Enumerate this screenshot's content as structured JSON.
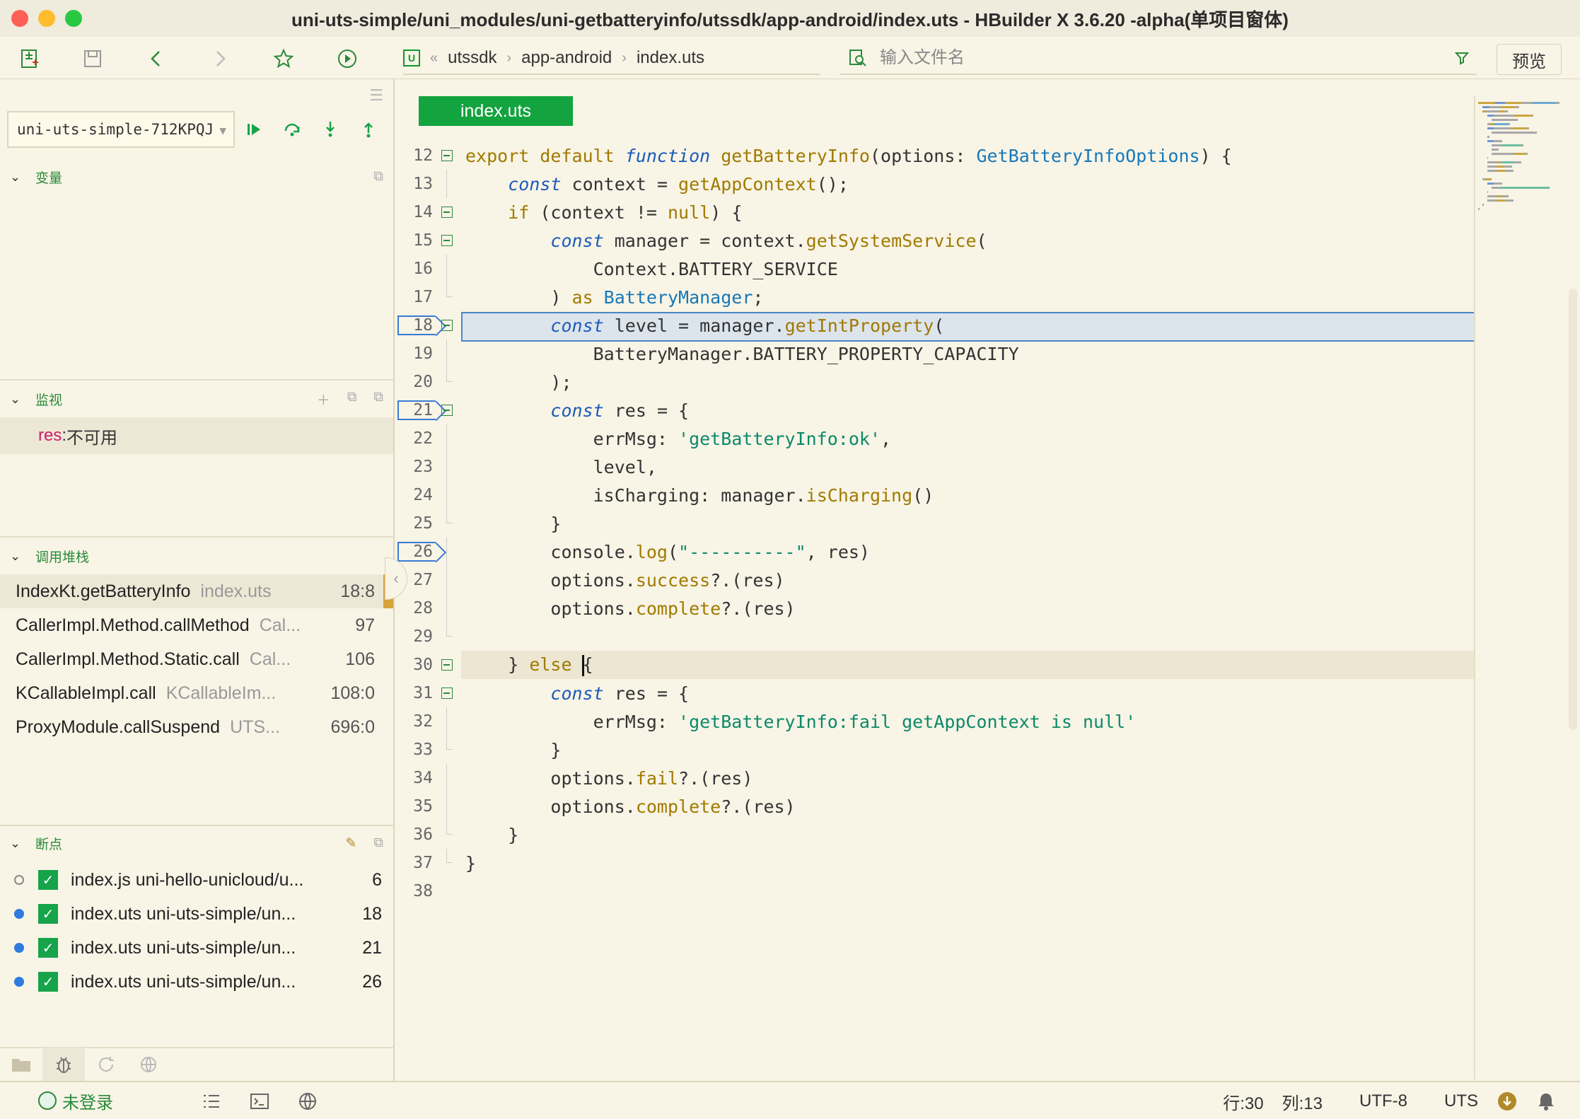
{
  "window": {
    "title": "uni-uts-simple/uni_modules/uni-getbatteryinfo/utssdk/app-android/index.uts - HBuilder X 3.6.20 -alpha(单项目窗体)"
  },
  "toolbar": {
    "breadcrumb": [
      "utssdk",
      "app-android",
      "index.uts"
    ],
    "breadcrumb_prefix": "«",
    "search_placeholder": "输入文件名",
    "preview_label": "预览"
  },
  "debug": {
    "device": "uni-uts-simple-712KPQJ",
    "variables_title": "变量",
    "watch_title": "监视",
    "watch_items": [
      {
        "key": "res",
        "value": "不可用"
      }
    ],
    "callstack_title": "调用堆栈",
    "callstack": [
      {
        "fn": "IndexKt.getBatteryInfo",
        "file": "index.uts",
        "line": "18:8"
      },
      {
        "fn": "CallerImpl.Method.callMethod",
        "file": "Cal...",
        "line": "97"
      },
      {
        "fn": "CallerImpl.Method.Static.call",
        "file": "Cal...",
        "line": "106"
      },
      {
        "fn": "KCallableImpl.call",
        "file": "KCallableIm...",
        "line": "108:0"
      },
      {
        "fn": "ProxyModule.callSuspend",
        "file": "UTS...",
        "line": "696:0"
      }
    ],
    "breakpoints_title": "断点",
    "breakpoints": [
      {
        "text": "index.js uni-hello-unicloud/u...",
        "line": "6",
        "dot": "#888888",
        "hollow": true
      },
      {
        "text": "index.uts uni-uts-simple/un...",
        "line": "18",
        "dot": "#2f7be0",
        "hollow": false
      },
      {
        "text": "index.uts uni-uts-simple/un...",
        "line": "21",
        "dot": "#2f7be0",
        "hollow": false
      },
      {
        "text": "index.uts uni-uts-simple/un...",
        "line": "26",
        "dot": "#2f7be0",
        "hollow": false
      }
    ]
  },
  "editor": {
    "tab": "index.uts",
    "lines": [
      {
        "n": "12",
        "fold": "box",
        "bp": false,
        "hl": "",
        "tokens": [
          [
            "kw",
            "export default "
          ],
          [
            "kwi",
            "function "
          ],
          [
            "fnn",
            "getBatteryInfo"
          ],
          [
            "",
            "(options: "
          ],
          [
            "ty",
            "GetBatteryInfoOptions"
          ],
          [
            "",
            ") {"
          ]
        ]
      },
      {
        "n": "13",
        "fold": "line",
        "bp": false,
        "hl": "",
        "tokens": [
          [
            "",
            "    "
          ],
          [
            "kwi",
            "const "
          ],
          [
            "",
            "context = "
          ],
          [
            "fnn",
            "getAppContext"
          ],
          [
            "",
            "();"
          ]
        ]
      },
      {
        "n": "14",
        "fold": "box",
        "bp": false,
        "hl": "",
        "tokens": [
          [
            "",
            "    "
          ],
          [
            "kw",
            "if "
          ],
          [
            "",
            "(context != "
          ],
          [
            "kw",
            "null"
          ],
          [
            "",
            ") {"
          ]
        ]
      },
      {
        "n": "15",
        "fold": "box",
        "bp": false,
        "hl": "",
        "tokens": [
          [
            "",
            "        "
          ],
          [
            "kwi",
            "const "
          ],
          [
            "",
            "manager = context."
          ],
          [
            "fnn",
            "getSystemService"
          ],
          [
            "",
            "("
          ]
        ]
      },
      {
        "n": "16",
        "fold": "line",
        "bp": false,
        "hl": "",
        "tokens": [
          [
            "",
            "            Context.BATTERY_SERVICE"
          ]
        ]
      },
      {
        "n": "17",
        "fold": "tick",
        "bp": false,
        "hl": "",
        "tokens": [
          [
            "",
            "        ) "
          ],
          [
            "kw",
            "as "
          ],
          [
            "ty",
            "BatteryManager"
          ],
          [
            "",
            ";"
          ]
        ]
      },
      {
        "n": "18",
        "fold": "box",
        "bp": true,
        "hl": "blue",
        "tokens": [
          [
            "",
            "        "
          ],
          [
            "kwi",
            "const "
          ],
          [
            "",
            "level = manager."
          ],
          [
            "fnn",
            "getIntProperty"
          ],
          [
            "",
            "("
          ]
        ]
      },
      {
        "n": "19",
        "fold": "line",
        "bp": false,
        "hl": "",
        "tokens": [
          [
            "",
            "            BatteryManager.BATTERY_PROPERTY_CAPACITY"
          ]
        ]
      },
      {
        "n": "20",
        "fold": "tick",
        "bp": false,
        "hl": "",
        "tokens": [
          [
            "",
            "        );"
          ]
        ]
      },
      {
        "n": "21",
        "fold": "box",
        "bp": true,
        "hl": "",
        "tokens": [
          [
            "",
            "        "
          ],
          [
            "kwi",
            "const "
          ],
          [
            "",
            "res = {"
          ]
        ]
      },
      {
        "n": "22",
        "fold": "line",
        "bp": false,
        "hl": "",
        "tokens": [
          [
            "",
            "            errMsg: "
          ],
          [
            "str",
            "'getBatteryInfo:ok'"
          ],
          [
            "",
            ","
          ]
        ]
      },
      {
        "n": "23",
        "fold": "line",
        "bp": false,
        "hl": "",
        "tokens": [
          [
            "",
            "            level,"
          ]
        ]
      },
      {
        "n": "24",
        "fold": "line",
        "bp": false,
        "hl": "",
        "tokens": [
          [
            "",
            "            isCharging: manager."
          ],
          [
            "fnn",
            "isCharging"
          ],
          [
            "",
            "()"
          ]
        ]
      },
      {
        "n": "25",
        "fold": "tick",
        "bp": false,
        "hl": "",
        "tokens": [
          [
            "",
            "        }"
          ]
        ]
      },
      {
        "n": "26",
        "fold": "line",
        "bp": true,
        "hl": "",
        "tokens": [
          [
            "",
            "        console."
          ],
          [
            "fnn",
            "log"
          ],
          [
            "",
            "("
          ],
          [
            "str",
            "\"----------\""
          ],
          [
            "",
            ", res)"
          ]
        ]
      },
      {
        "n": "27",
        "fold": "line",
        "bp": false,
        "hl": "",
        "tokens": [
          [
            "",
            "        options."
          ],
          [
            "fnn",
            "success"
          ],
          [
            "",
            "?.(res)"
          ]
        ]
      },
      {
        "n": "28",
        "fold": "line",
        "bp": false,
        "hl": "",
        "tokens": [
          [
            "",
            "        options."
          ],
          [
            "fnn",
            "complete"
          ],
          [
            "",
            "?.(res)"
          ]
        ]
      },
      {
        "n": "29",
        "fold": "tick",
        "bp": false,
        "hl": "",
        "tokens": [
          [
            "",
            ""
          ]
        ]
      },
      {
        "n": "30",
        "fold": "box",
        "bp": false,
        "hl": "cur",
        "tokens": [
          [
            "",
            "    } "
          ],
          [
            "kw",
            "else "
          ],
          [
            "",
            "{"
          ]
        ]
      },
      {
        "n": "31",
        "fold": "box",
        "bp": false,
        "hl": "",
        "tokens": [
          [
            "",
            "        "
          ],
          [
            "kwi",
            "const "
          ],
          [
            "",
            "res = {"
          ]
        ]
      },
      {
        "n": "32",
        "fold": "line",
        "bp": false,
        "hl": "",
        "tokens": [
          [
            "",
            "            errMsg: "
          ],
          [
            "str",
            "'getBatteryInfo:fail getAppContext is null'"
          ]
        ]
      },
      {
        "n": "33",
        "fold": "tick",
        "bp": false,
        "hl": "",
        "tokens": [
          [
            "",
            "        }"
          ]
        ]
      },
      {
        "n": "34",
        "fold": "line",
        "bp": false,
        "hl": "",
        "tokens": [
          [
            "",
            "        options."
          ],
          [
            "fnn",
            "fail"
          ],
          [
            "",
            "?.(res)"
          ]
        ]
      },
      {
        "n": "35",
        "fold": "line",
        "bp": false,
        "hl": "",
        "tokens": [
          [
            "",
            "        options."
          ],
          [
            "fnn",
            "complete"
          ],
          [
            "",
            "?.(res)"
          ]
        ]
      },
      {
        "n": "36",
        "fold": "tick",
        "bp": false,
        "hl": "",
        "tokens": [
          [
            "",
            "    }"
          ]
        ]
      },
      {
        "n": "37",
        "fold": "tick",
        "bp": false,
        "hl": "",
        "tokens": [
          [
            "",
            "}"
          ]
        ]
      },
      {
        "n": "38",
        "fold": "",
        "bp": false,
        "hl": "",
        "tokens": [
          [
            "",
            ""
          ]
        ]
      }
    ]
  },
  "status": {
    "login": "未登录",
    "position": "行:30",
    "column": "列:13",
    "encoding": "UTF-8",
    "language": "UTS"
  },
  "colors": {
    "accent": "#13a33f",
    "breakpoint": "#2f7be0",
    "selection": "#dce4ec"
  }
}
